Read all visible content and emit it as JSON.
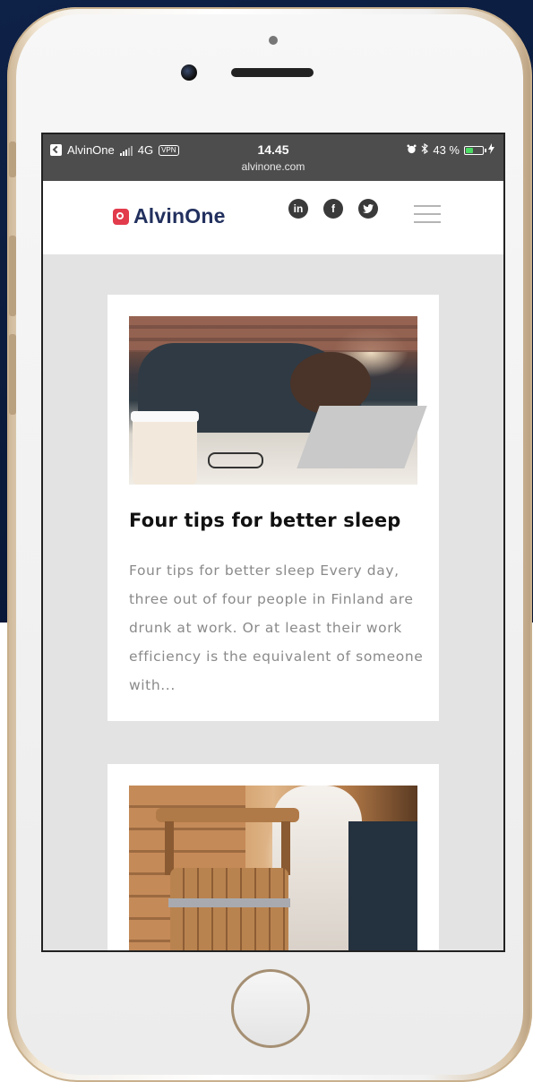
{
  "statusbar": {
    "back_app": "AlvinOne",
    "network": "4G",
    "vpn": "VPN",
    "time": "14.45",
    "url": "alvinone.com",
    "battery": "43 %",
    "battery_level": 0.43
  },
  "header": {
    "logo_text": "AlvinOne",
    "social": [
      {
        "icon": "linkedin-icon",
        "glyph": "in"
      },
      {
        "icon": "facebook-icon",
        "glyph": "f"
      },
      {
        "icon": "twitter-icon",
        "glyph": "t"
      }
    ],
    "menu_icon": "hamburger-icon"
  },
  "articles": [
    {
      "title": "Four tips for better sleep",
      "excerpt": "Four tips for better sleep Every day, three out of four people in Finland are drunk at work. Or at least their work efficiency is the equivalent of someone with..."
    },
    {
      "title": "",
      "excerpt": ""
    }
  ],
  "colors": {
    "brand_red": "#e23b4b",
    "brand_navy": "#22305e",
    "statusbar": "#4d4d4d",
    "page_bg": "#e3e3e3",
    "excerpt_text": "#8a8a8a"
  }
}
